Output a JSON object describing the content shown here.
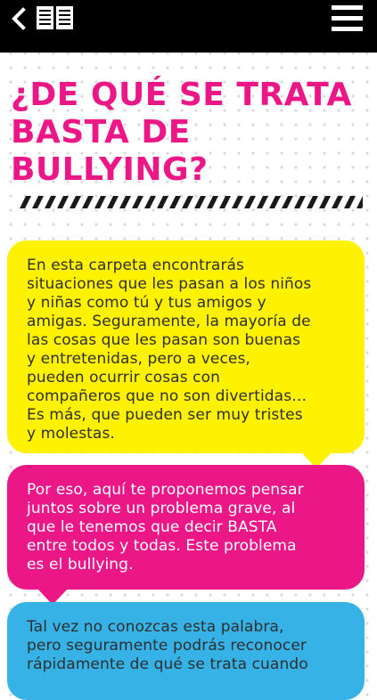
{
  "header": {
    "back_icon": "chevron-left-icon",
    "book_icon": "open-book-icon",
    "menu_icon": "hamburger-menu-icon",
    "background": "#000000"
  },
  "page": {
    "title": "¿DE QUÉ SE TRATA\nBASTA DE\nBULLYING?",
    "title_color": "#ec1787"
  },
  "bubbles": [
    {
      "color": "#fff200",
      "text": "En esta carpeta encontrarás\nsituaciones que les pasan a los niños\ny niñas como tú y tus amigos y\namigas. Seguramente, la mayoría de\nlas cosas que les pasan son buenas\ny entretenidas, pero a veces,\npueden ocurrir cosas con\ncompañeros que no son divertidas…\nEs más, que pueden ser muy tristes\ny molestas."
    },
    {
      "color": "#ec1787",
      "text": "Por eso, aquí te proponemos pensar\njuntos sobre un problema grave, al\nque le tenemos que decir BASTA\nentre todos y todas. Este problema\nes el bullying."
    },
    {
      "color": "#36b2e6",
      "text": "Tal vez no conozcas esta palabra,\npero seguramente podrás reconocer\nrápidamente de qué se trata cuando"
    }
  ]
}
